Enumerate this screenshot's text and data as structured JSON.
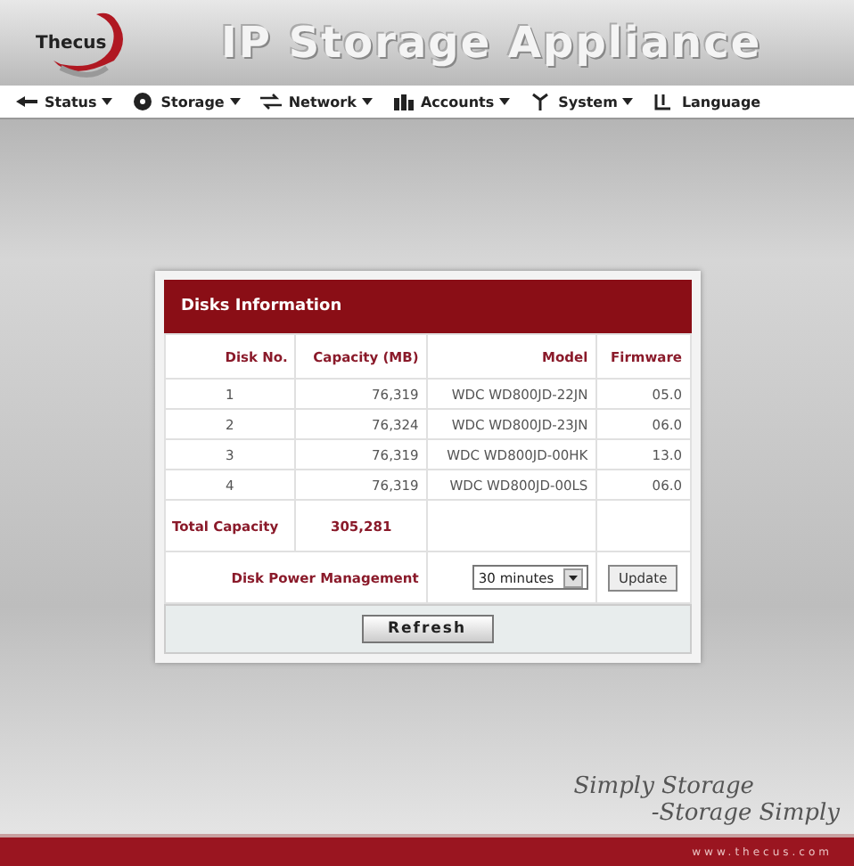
{
  "header": {
    "logo": "Thecus",
    "title": "IP Storage Appliance"
  },
  "menu": [
    {
      "label": "Status",
      "dropdown": true
    },
    {
      "label": "Storage",
      "dropdown": true
    },
    {
      "label": "Network",
      "dropdown": true
    },
    {
      "label": "Accounts",
      "dropdown": true
    },
    {
      "label": "System",
      "dropdown": true
    },
    {
      "label": "Language",
      "dropdown": false
    }
  ],
  "panel": {
    "title": "Disks Information",
    "columns": [
      "Disk No.",
      "Capacity (MB)",
      "Model",
      "Firmware"
    ],
    "rows": [
      [
        "1",
        "76,319",
        "WDC WD800JD-22JN",
        "05.0"
      ],
      [
        "2",
        "76,324",
        "WDC WD800JD-23JN",
        "06.0"
      ],
      [
        "3",
        "76,319",
        "WDC WD800JD-00HK",
        "13.0"
      ],
      [
        "4",
        "76,319",
        "WDC WD800JD-00LS",
        "06.0"
      ]
    ],
    "total": {
      "label": "Total Capacity",
      "value": "305,281"
    },
    "power": {
      "label": "Disk Power Management",
      "value": "30 minutes",
      "button": "Update"
    },
    "refresh": "Refresh"
  },
  "footer": {
    "slogan_1": "Simply Storage",
    "slogan_2": "-Storage Simply",
    "url": "www.thecus.com"
  }
}
